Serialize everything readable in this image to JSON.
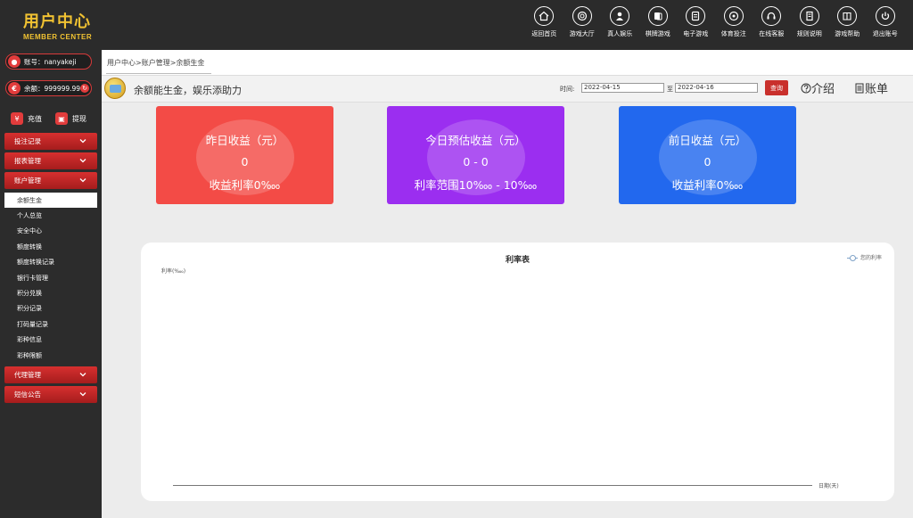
{
  "header": {
    "logo_cn": "用户中心",
    "logo_en": "MEMBER CENTER",
    "nav": [
      {
        "label": "返回首页",
        "icon": "home-icon"
      },
      {
        "label": "游戏大厅",
        "icon": "lobby-icon"
      },
      {
        "label": "真人娱乐",
        "icon": "live-casino-icon"
      },
      {
        "label": "棋牌游戏",
        "icon": "cards-icon"
      },
      {
        "label": "电子游戏",
        "icon": "slots-icon"
      },
      {
        "label": "体育投注",
        "icon": "sports-icon"
      },
      {
        "label": "在线客服",
        "icon": "headset-icon"
      },
      {
        "label": "规则说明",
        "icon": "rules-icon"
      },
      {
        "label": "游戏帮助",
        "icon": "help-book-icon"
      },
      {
        "label": "退出账号",
        "icon": "power-icon"
      }
    ]
  },
  "sidebar": {
    "account": "账号：nanyakeji",
    "balance": "余额：999999.99",
    "recharge": "充值",
    "withdraw": "提现",
    "menus": {
      "bet_records": "投注记录",
      "report": "报表管理",
      "account_mgmt": "账户管理",
      "agent": "代理管理",
      "notice": "短信公告"
    },
    "sub_items": [
      "余额生金",
      "个人总览",
      "安全中心",
      "额度转换",
      "额度转换记录",
      "银行卡管理",
      "积分兑换",
      "积分记录",
      "打码量记录",
      "彩种信息",
      "彩种限额"
    ]
  },
  "breadcrumb": "用户中心>账户管理>余额生金",
  "infobar": {
    "slogan": "余额能生金，娱乐添助力",
    "time_label": "时间:",
    "start_date": "2022-04-15",
    "to_label": "至",
    "end_date": "2022-04-16",
    "query_label": "查询",
    "intro_label": "介绍",
    "bill_label": "账单"
  },
  "cards": [
    {
      "title": "昨日收益（元）",
      "value": "0",
      "rate": "收益利率0‱",
      "color": "#f34b46"
    },
    {
      "title": "今日预估收益（元）",
      "value": "0 - 0",
      "rate": "利率范围10‱ - 10‱",
      "color": "#9b2ef0"
    },
    {
      "title": "前日收益（元）",
      "value": "0",
      "rate": "收益利率0‱",
      "color": "#2268ee"
    }
  ],
  "chart_data": {
    "type": "line",
    "title": "利率表",
    "ylabel": "利率(‱)",
    "xlabel": "日期(天)",
    "series": [
      {
        "name": "您的利率",
        "values": []
      }
    ],
    "categories": [],
    "legend_position": "top-right",
    "grid": false
  }
}
